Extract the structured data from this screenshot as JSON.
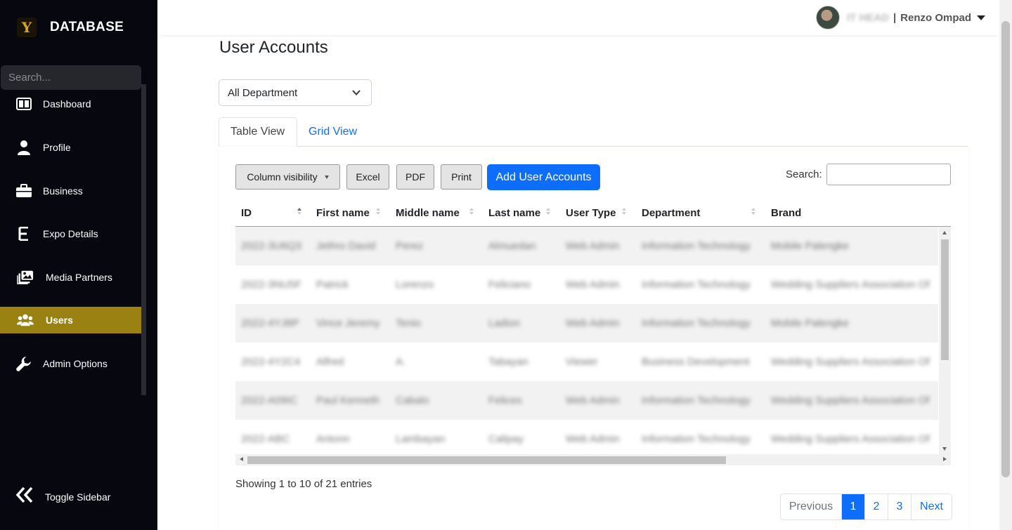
{
  "sidebar": {
    "brand_logo": "Y",
    "brand_name": "DATABASE",
    "search_placeholder": "Search...",
    "items": [
      {
        "label": "Dashboard",
        "icon": "dashboard-icon"
      },
      {
        "label": "Profile",
        "icon": "user-icon"
      },
      {
        "label": "Business",
        "icon": "briefcase-icon"
      },
      {
        "label": "Expo Details",
        "icon": "letter-e-icon"
      },
      {
        "label": "Media Partners",
        "icon": "photos-icon"
      },
      {
        "label": "Users",
        "icon": "users-icon",
        "active": true
      },
      {
        "label": "Admin Options",
        "icon": "wrench-icon"
      }
    ],
    "toggle_label": "Toggle Sidebar",
    "active_color": "#9a8212"
  },
  "header": {
    "user_role": "IT HEAD",
    "separator": "|",
    "user_name": "Renzo Ompad"
  },
  "main": {
    "title": "User Accounts",
    "department_filter": "All Department",
    "tabs": [
      {
        "label": "Table View",
        "active": true
      },
      {
        "label": "Grid View",
        "active": false
      }
    ],
    "buttons": {
      "column_visibility": "Column visibility",
      "excel": "Excel",
      "pdf": "PDF",
      "print": "Print",
      "add": "Add User Accounts"
    },
    "search_label": "Search:",
    "accent_color": "#0d6efd"
  },
  "table": {
    "columns": [
      "ID",
      "First name",
      "Middle name",
      "Last name",
      "User Type",
      "Department",
      "Brand"
    ],
    "rows": [
      [
        "2022-3U6Q3",
        "Jethro David",
        "Perez",
        "Almuedan",
        "Web Admin",
        "Information Technology",
        "Mobile Palengke"
      ],
      [
        "2022-3NU5F",
        "Patrick",
        "Lorenzo",
        "Feliciano",
        "Web Admin",
        "Information Technology",
        "Wedding Suppliers Association Of"
      ],
      [
        "2022-4YJ6P",
        "Vince Jeremy",
        "Tenio",
        "Ladion",
        "Web Admin",
        "Information Technology",
        "Mobile Palengke"
      ],
      [
        "2022-4Y2C4",
        "Alfred",
        "A.",
        "Tabayan",
        "Viewer",
        "Business Development",
        "Wedding Suppliers Association Of"
      ],
      [
        "2022-A09IC",
        "Paul Kenneth",
        "Cabalo",
        "Felices",
        "Web Admin",
        "Information Technology",
        "Wedding Suppliers Association Of"
      ],
      [
        "2022-ABC",
        "Antonn",
        "Lambayan",
        "Calipay",
        "Web Admin",
        "Information Technology",
        "Wedding Suppliers Association Of"
      ]
    ],
    "info": "Showing 1 to 10 of 21 entries",
    "pagination": [
      "Previous",
      "1",
      "2",
      "3",
      "Next"
    ],
    "current_page": "1"
  }
}
